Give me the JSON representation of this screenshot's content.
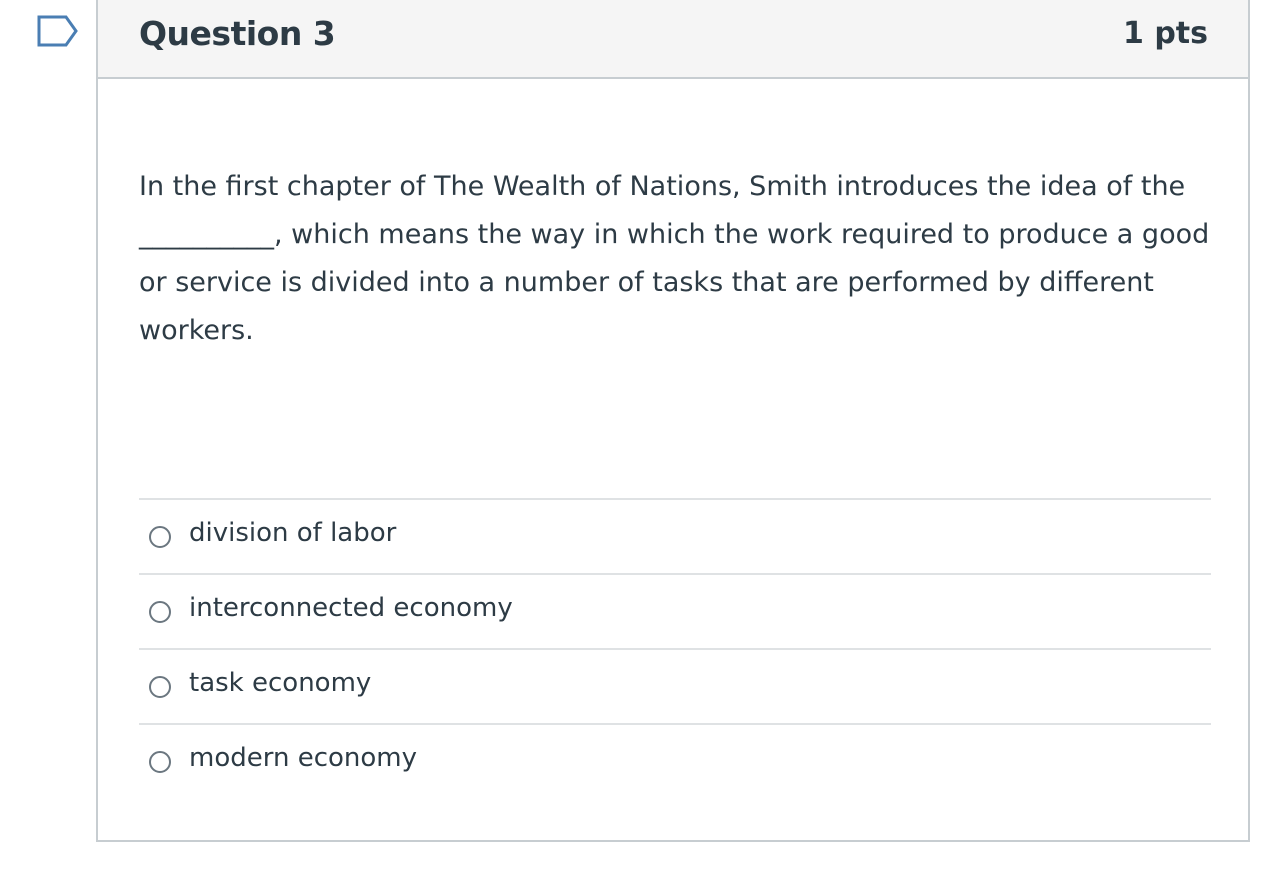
{
  "flag_icon": "bookmark-flag-icon",
  "question": {
    "title": "Question 3",
    "points": "1 pts",
    "text": "In the first chapter of The Wealth of Nations, Smith introduces the idea of the __________, which means the way in which the work required to produce a good or service is divided into a number of tasks that are performed by different workers."
  },
  "answers": [
    {
      "label": "division of labor",
      "selected": false
    },
    {
      "label": "interconnected economy",
      "selected": false
    },
    {
      "label": "task economy",
      "selected": false
    },
    {
      "label": "modern economy",
      "selected": false
    }
  ],
  "colors": {
    "text": "#2d3b45",
    "header_bg": "#f5f5f5",
    "border": "#c7cdd1",
    "flag_outline": "#4a7eb3"
  }
}
